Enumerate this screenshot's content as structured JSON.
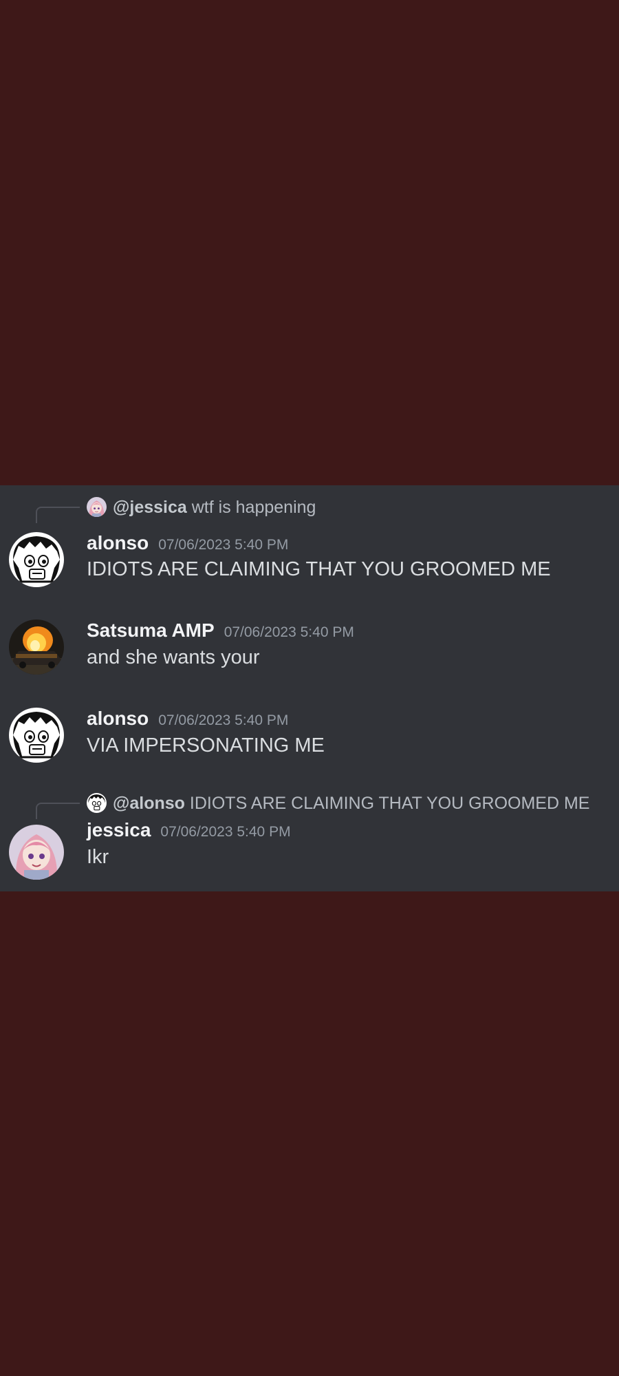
{
  "messages": [
    {
      "reply": {
        "mention": "@jessica",
        "text": "wtf is happening",
        "avatar_icon": "anime-girl-avatar-icon"
      },
      "author": "alonso",
      "timestamp": "07/06/2023 5:40 PM",
      "text": "IDIOTS ARE CLAIMING THAT YOU GROOMED ME",
      "avatar_icon": "cartoon-face-avatar-icon"
    },
    {
      "author": "Satsuma AMP",
      "timestamp": "07/06/2023 5:40 PM",
      "text": "and she wants your",
      "avatar_icon": "burning-car-avatar-icon"
    },
    {
      "author": "alonso",
      "timestamp": "07/06/2023 5:40 PM",
      "text": "VIA IMPERSONATING ME",
      "avatar_icon": "cartoon-face-avatar-icon"
    },
    {
      "reply": {
        "mention": "@alonso",
        "text": "IDIOTS ARE CLAIMING THAT YOU GROOMED ME",
        "avatar_icon": "cartoon-face-avatar-icon"
      },
      "author": "jessica",
      "timestamp": "07/06/2023 5:40 PM",
      "text": "Ikr",
      "avatar_icon": "anime-girl-avatar-icon"
    }
  ],
  "colors": {
    "background": "#3e1818",
    "panel": "#313338",
    "username": "#f2f3f5",
    "timestamp": "#949ba4",
    "message_text": "#dbdee1",
    "reply_text": "#b5bac1"
  }
}
